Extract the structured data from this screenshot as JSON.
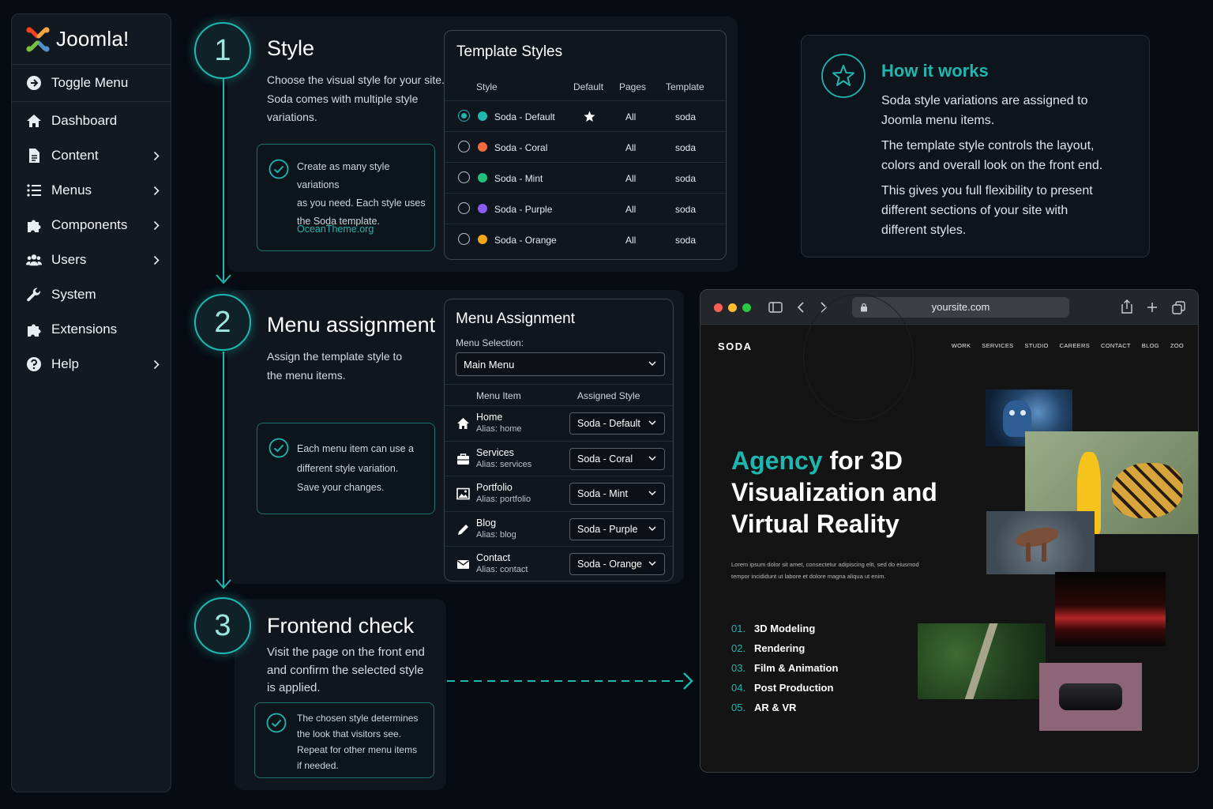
{
  "app": {
    "name": "Joomla!"
  },
  "sidebar": {
    "items": [
      {
        "label": "Toggle Menu",
        "icon": "toggle-icon",
        "chevron": false
      },
      {
        "label": "Dashboard",
        "icon": "home-icon",
        "chevron": false
      },
      {
        "label": "Content",
        "icon": "file-icon",
        "chevron": true
      },
      {
        "label": "Menus",
        "icon": "list-icon",
        "chevron": true
      },
      {
        "label": "Components",
        "icon": "puzzle-icon",
        "chevron": true
      },
      {
        "label": "Users",
        "icon": "users-icon",
        "chevron": true
      },
      {
        "label": "System",
        "icon": "wrench-icon",
        "chevron": false
      },
      {
        "label": "Extensions",
        "icon": "puzzle-icon",
        "chevron": false
      },
      {
        "label": "Help",
        "icon": "help-icon",
        "chevron": true
      }
    ]
  },
  "steps": [
    {
      "number": "1",
      "title": "Style",
      "desc": [
        "Choose the visual style for your site.",
        "Soda comes with multiple style",
        "variations."
      ],
      "note": [
        "Create as many style variations",
        "as you need. Each style uses",
        "the Soda template."
      ],
      "link": "OceanTheme.org"
    },
    {
      "number": "2",
      "title": "Menu assignment",
      "desc": [
        "Assign the template style to",
        "the menu items."
      ],
      "note": [
        "Each menu item can use a",
        "different style variation.",
        "Save your changes."
      ]
    },
    {
      "number": "3",
      "title": "Frontend check",
      "desc": [
        "Visit the page on the front end",
        "and confirm the selected style",
        "is applied."
      ],
      "note": [
        "The chosen style determines",
        "the look that visitors see.",
        "Repeat for other menu items",
        "if needed."
      ]
    }
  ],
  "template_styles": {
    "title": "Template Styles",
    "headers": [
      "Style",
      "Default",
      "Pages",
      "Template"
    ],
    "rows": [
      {
        "style": "Soda - Default",
        "color": "#1fb6b0",
        "default": true,
        "pages": "All",
        "template": "soda",
        "selected": true
      },
      {
        "style": "Soda - Coral",
        "color": "#f06a3f",
        "default": false,
        "pages": "All",
        "template": "soda",
        "selected": false
      },
      {
        "style": "Soda - Mint",
        "color": "#22c07a",
        "default": false,
        "pages": "All",
        "template": "soda",
        "selected": false
      },
      {
        "style": "Soda - Purple",
        "color": "#8a5cf0",
        "default": false,
        "pages": "All",
        "template": "soda",
        "selected": false
      },
      {
        "style": "Soda - Orange",
        "color": "#f2a516",
        "default": false,
        "pages": "All",
        "template": "soda",
        "selected": false
      }
    ]
  },
  "menu_assignment": {
    "title": "Menu Assignment",
    "selection_label": "Menu Selection:",
    "selection_value": "Main Menu",
    "headers": [
      "Menu Item",
      "Assigned Style"
    ],
    "rows": [
      {
        "name": "Home",
        "alias": "Alias: home",
        "style": "Soda - Default",
        "icon": "home-icon"
      },
      {
        "name": "Services",
        "alias": "Alias: services",
        "style": "Soda - Coral",
        "icon": "briefcase-icon"
      },
      {
        "name": "Portfolio",
        "alias": "Alias: portfolio",
        "style": "Soda - Mint",
        "icon": "image-icon"
      },
      {
        "name": "Blog",
        "alias": "Alias: blog",
        "style": "Soda - Purple",
        "icon": "pencil-icon"
      },
      {
        "name": "Contact",
        "alias": "Alias: contact",
        "style": "Soda - Orange",
        "icon": "envelope-icon"
      }
    ]
  },
  "how_it_works": {
    "title": "How it works",
    "paragraphs": [
      [
        "Soda style variations are assigned to",
        "Joomla menu items."
      ],
      [
        "The template style controls the layout,",
        "colors and overall look on the front end."
      ],
      [
        "This gives you full flexibility to present",
        "different sections of your site with",
        "different styles."
      ]
    ]
  },
  "browser": {
    "url": "yoursite.com",
    "site": {
      "brand": "SODA",
      "nav": [
        "WORK",
        "SERVICES",
        "STUDIO",
        "CAREERS",
        "CONTACT",
        "BLOG",
        "ZOO"
      ],
      "hero_accent": "Agency",
      "hero_line1_rest": " for 3D",
      "hero_line2": "Visualization and",
      "hero_line3": "Virtual Reality",
      "lorem": [
        "Lorem ipsum dolor sit amet, consectetur adipiscing elit, sed do eiusmod",
        "tempor incididunt ut labore et dolore magna aliqua ut enim."
      ],
      "services": [
        {
          "n": "01.",
          "label": "3D Modeling"
        },
        {
          "n": "02.",
          "label": "Rendering"
        },
        {
          "n": "03.",
          "label": "Film & Animation"
        },
        {
          "n": "04.",
          "label": "Post Production"
        },
        {
          "n": "05.",
          "label": "AR & VR"
        }
      ]
    }
  },
  "colors": {
    "accent": "#1fb6b0",
    "background": "#070b12",
    "panel": "#0f161e"
  }
}
